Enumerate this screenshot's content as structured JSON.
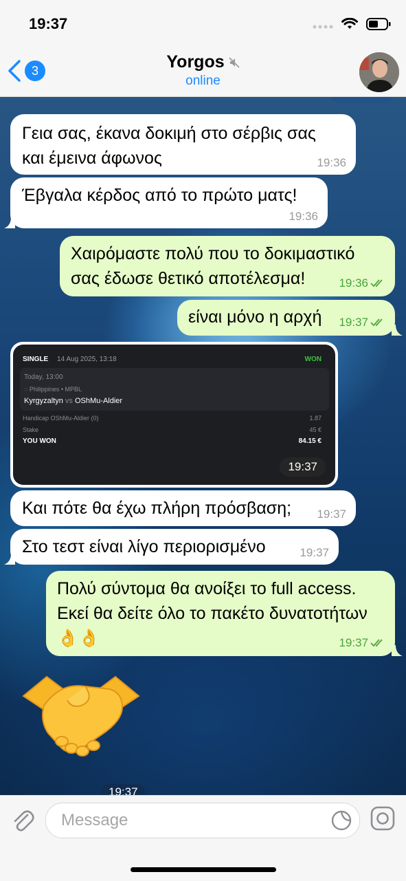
{
  "status_bar": {
    "time": "19:37"
  },
  "header": {
    "back_count": "3",
    "contact_name": "Yorgos",
    "contact_status": "online",
    "muted": true
  },
  "messages": [
    {
      "dir": "in",
      "text": "Γεια σας, έκανα δοκιμή στο σέρβις σας και έμεινα άφωνος",
      "time": "19:36"
    },
    {
      "dir": "in",
      "text": "Έβγαλα κέρδος από το πρώτο ματς!",
      "time": "19:36"
    },
    {
      "dir": "out",
      "text": "Χαιρόμαστε πολύ που το δοκιμαστικό σας έδωσε θετικό αποτέλεσμα!",
      "time": "19:36",
      "read": true
    },
    {
      "dir": "out",
      "text": "είναι μόνο η αρχή",
      "time": "19:37",
      "read": true
    },
    {
      "dir": "in",
      "text": "Και πότε θα έχω πλήρη πρόσβαση;",
      "time": "19:37"
    },
    {
      "dir": "in",
      "text": "Στο τεστ είναι λίγο περιορισμένο",
      "time": "19:37"
    },
    {
      "dir": "out",
      "text": "Πολύ σύντομα θα ανοίξει το full access. Εκεί θα δείτε όλο το πακέτο δυνατοτήτων👌👌",
      "time": "19:37",
      "read": true
    }
  ],
  "bet_slip": {
    "type": "SINGLE",
    "date": "14 Aug 2025, 13:18",
    "result": "WON",
    "when": "Today, 13:00",
    "league": "Philippines • MPBL",
    "team_home": "Kyrgyzaltyn",
    "vs": "vs",
    "team_away": "OShMu-Aldier",
    "market_label": "Handicap OShMu-Aldier (0)",
    "odds": "1.87",
    "stake_label": "Stake",
    "stake": "45 €",
    "you_won_label": "YOU WON",
    "payout": "84.15 €",
    "time": "19:37"
  },
  "sticker": {
    "emoji": "🤝",
    "time": "19:37"
  },
  "input": {
    "placeholder": "Message"
  },
  "colors": {
    "accent": "#1a8cff",
    "outgoing_bubble": "#e5fcc8",
    "incoming_bubble": "#ffffff",
    "read_ticks": "#4aa43b"
  }
}
